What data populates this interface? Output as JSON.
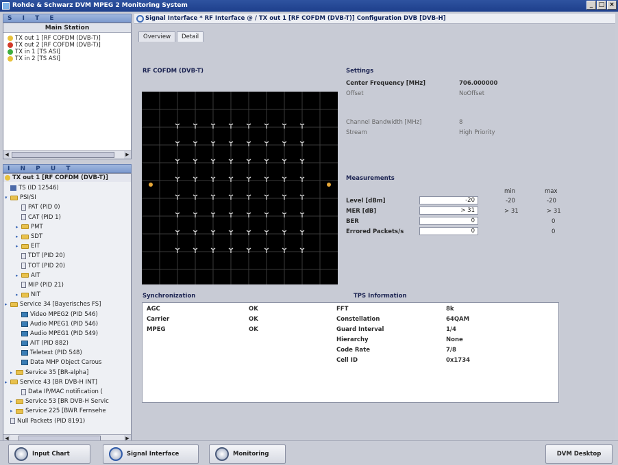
{
  "window": {
    "title": "Rohde & Schwarz DVM MPEG 2 Monitoring System",
    "controls": [
      "_",
      "□",
      "×"
    ]
  },
  "site": {
    "header": "S I T E",
    "station": "Main Station",
    "items": [
      {
        "label": "TX out 1 [RF COFDM (DVB-T)]",
        "status": "#e8c13a"
      },
      {
        "label": "TX out 2 [RF COFDM (DVB-T)]",
        "status": "#d23a2a"
      },
      {
        "label": "TX in 1 [TS ASI]",
        "status": "#3fae3f"
      },
      {
        "label": "TX in 2 [TS ASI]",
        "status": "#e8c13a"
      }
    ]
  },
  "input": {
    "header": "I N P U T",
    "root": "TX out 1 [RF COFDM (DVB-T)]",
    "items": [
      {
        "label": "TS (ID 12546)",
        "icon": "ts-icon",
        "indent": 1
      },
      {
        "label": "PSI/SI",
        "icon": "folder-icon",
        "indent": 0,
        "expanded": true
      },
      {
        "label": "PAT (PID 0)",
        "icon": "document-icon",
        "indent": 3
      },
      {
        "label": "CAT (PID 1)",
        "icon": "document-icon",
        "indent": 3
      },
      {
        "label": "PMT",
        "icon": "folder-icon",
        "indent": 2
      },
      {
        "label": "SDT",
        "icon": "folder-icon",
        "indent": 2
      },
      {
        "label": "EIT",
        "icon": "folder-icon",
        "indent": 2
      },
      {
        "label": "TDT (PID 20)",
        "icon": "document-icon",
        "indent": 3
      },
      {
        "label": "TOT (PID 20)",
        "icon": "document-icon",
        "indent": 3
      },
      {
        "label": "AIT",
        "icon": "folder-icon",
        "indent": 2
      },
      {
        "label": "MIP (PID 21)",
        "icon": "document-icon",
        "indent": 3
      },
      {
        "label": "NIT",
        "icon": "folder-icon",
        "indent": 2
      },
      {
        "label": "Service 34 [Bayerisches FS]",
        "icon": "folder-icon",
        "indent": 0
      },
      {
        "label": "Video MPEG2 (PID 546)",
        "icon": "video-icon",
        "indent": 3
      },
      {
        "label": "Audio MPEG1 (PID 546)",
        "icon": "video-icon",
        "indent": 3
      },
      {
        "label": "Audio MPEG1 (PID 549)",
        "icon": "video-icon",
        "indent": 3
      },
      {
        "label": "AIT (PID 882)",
        "icon": "video-icon",
        "indent": 3
      },
      {
        "label": "Teletext (PID 548)",
        "icon": "video-icon",
        "indent": 3
      },
      {
        "label": "Data MHP Object Carous",
        "icon": "video-icon",
        "indent": 3
      },
      {
        "label": "Service 35 [BR-alpha]",
        "icon": "folder-icon",
        "indent": 1
      },
      {
        "label": "Service 43 [BR DVB-H INT]",
        "icon": "folder-icon",
        "indent": 0
      },
      {
        "label": "Data IP/MAC notification (",
        "icon": "document-icon",
        "indent": 3
      },
      {
        "label": "Service 53 [BR DVB-H Servic",
        "icon": "folder-icon",
        "indent": 1
      },
      {
        "label": "Service 225 [BWR Fernsehe",
        "icon": "folder-icon",
        "indent": 1
      },
      {
        "label": "Null Packets (PID 8191)",
        "icon": "document-icon",
        "indent": 1
      }
    ]
  },
  "path": "Signal Interface * RF Interface @ / TX out 1 [RF COFDM (DVB-T)] Configuration DVB [DVB-H]",
  "tabs": [
    {
      "label": "Overview",
      "active": false
    },
    {
      "label": "Detail",
      "active": true
    }
  ],
  "constellation": {
    "title": "RF COFDM (DVB-T)"
  },
  "settings": {
    "title": "Settings",
    "rows": [
      {
        "label": "Center Frequency [MHz]",
        "value": "706.000000",
        "bold": true
      },
      {
        "label": "Offset",
        "value": "NoOffset",
        "bold": false
      },
      {
        "label": "Channel Bandwidth [MHz]",
        "value": "8",
        "bold": false
      },
      {
        "label": "Stream",
        "value": "High Priority",
        "bold": false
      }
    ]
  },
  "measurements": {
    "title": "Measurements",
    "col_min": "min",
    "col_max": "max",
    "rows": [
      {
        "label": "Level [dBm]",
        "value": "-20",
        "min": "-20",
        "max": "-20"
      },
      {
        "label": "MER [dB]",
        "value": "> 31",
        "min": "> 31",
        "max": "> 31"
      },
      {
        "label": "BER",
        "value": "0",
        "min": "",
        "max": "0"
      },
      {
        "label": "Errored Packets/s",
        "value": "0",
        "min": "",
        "max": "0"
      }
    ]
  },
  "sync": {
    "title": "Synchronization",
    "rows": [
      {
        "label": "AGC",
        "value": "OK"
      },
      {
        "label": "Carrier",
        "value": "OK"
      },
      {
        "label": "MPEG",
        "value": "OK"
      }
    ]
  },
  "tps": {
    "title": "TPS Information",
    "rows": [
      {
        "label": "FFT",
        "value": "8k"
      },
      {
        "label": "Constellation",
        "value": "64QAM"
      },
      {
        "label": "Guard Interval",
        "value": "1/4"
      },
      {
        "label": "Hierarchy",
        "value": "None"
      },
      {
        "label": "Code Rate",
        "value": "7/8"
      },
      {
        "label": "Cell ID",
        "value": "0x1734"
      }
    ]
  },
  "taskbar": {
    "input_chart": "Input Chart",
    "signal_interface": "Signal Interface",
    "monitoring": "Monitoring",
    "desktop": "DVM Desktop"
  }
}
